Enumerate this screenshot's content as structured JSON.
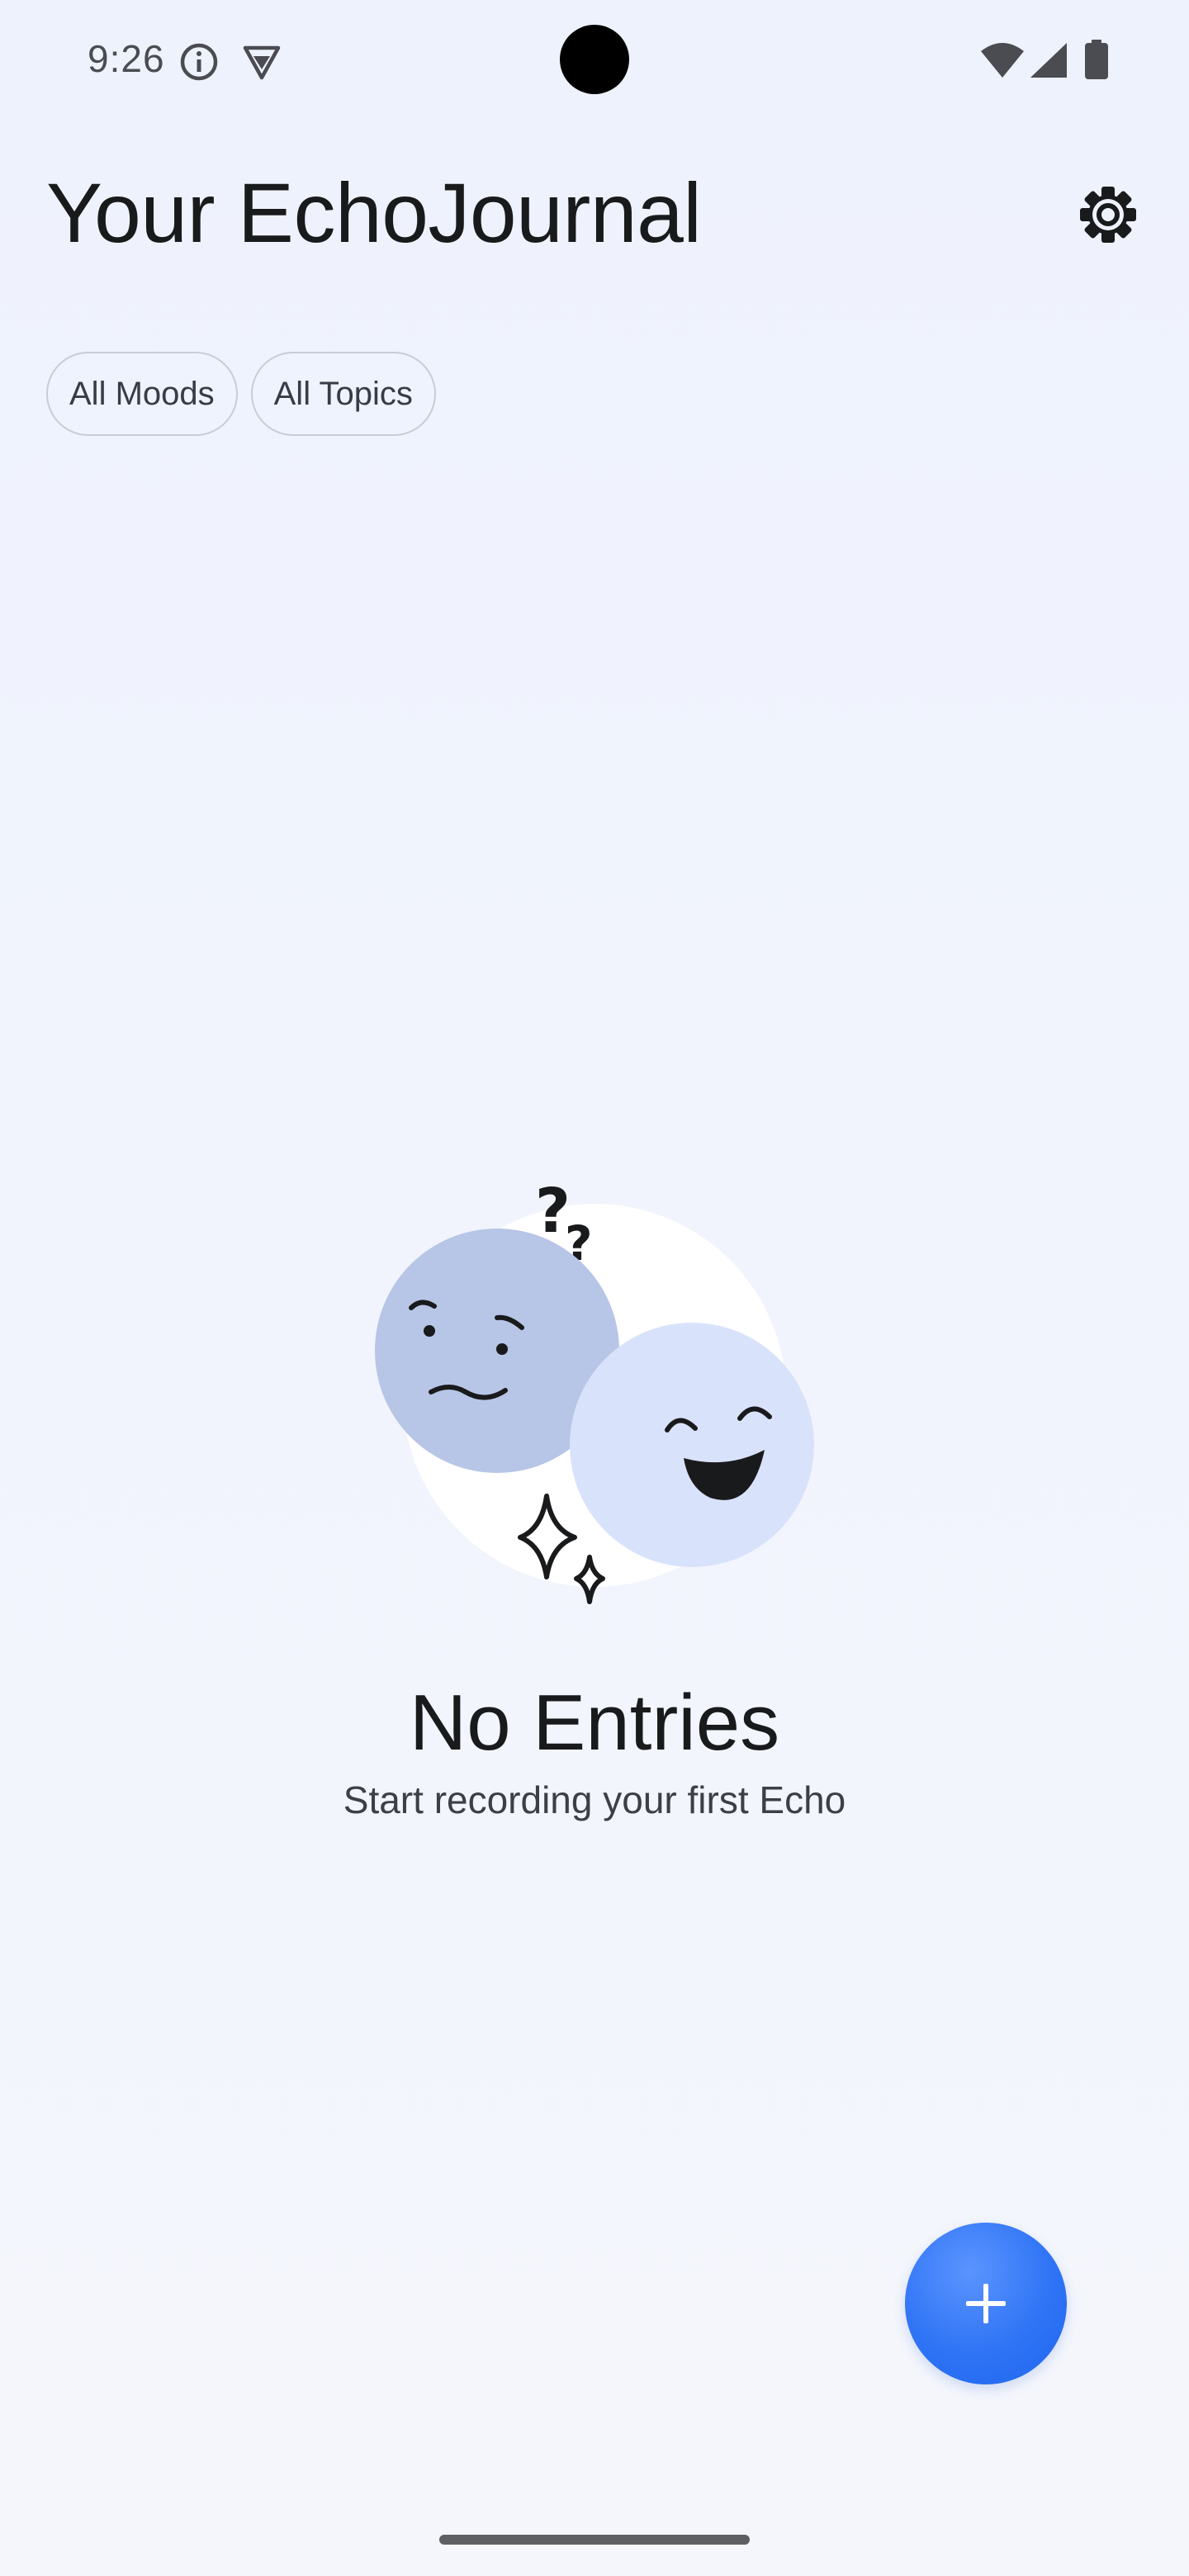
{
  "status_bar": {
    "time": "9:26",
    "icons": [
      "info-icon",
      "vpn-shield-icon",
      "wifi-icon",
      "cell-signal-icon",
      "battery-icon"
    ]
  },
  "header": {
    "title": "Your EchoJournal",
    "settings_icon": "gear-icon"
  },
  "filters": {
    "moods_label": "All Moods",
    "topics_label": "All Topics"
  },
  "empty_state": {
    "illustration": "mood-faces-illustration",
    "title": "No Entries",
    "subtitle": "Start recording your first Echo"
  },
  "fab": {
    "icon": "plus-icon"
  },
  "colors": {
    "accent": "#2F74F5",
    "background": "#EFF3FD",
    "sad_face": "#B7C5E6",
    "happy_face": "#D9E2FB"
  }
}
